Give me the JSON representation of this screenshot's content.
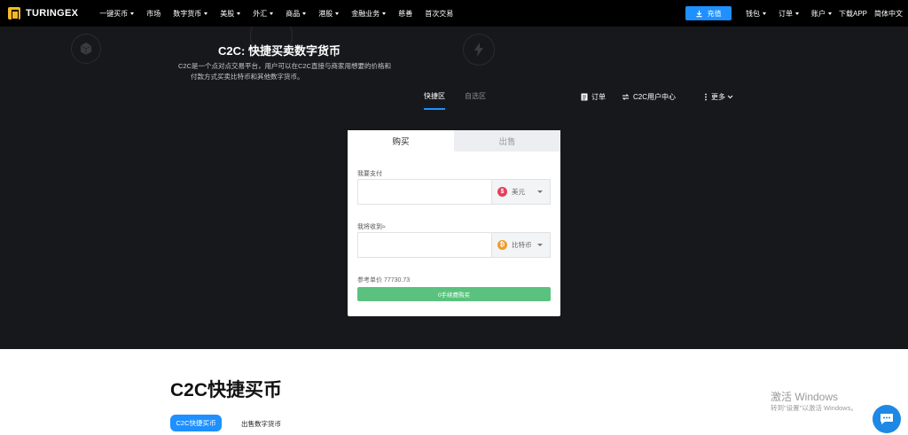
{
  "brand": {
    "name": "TURINGEX"
  },
  "nav": {
    "items": [
      {
        "label": "一键买币",
        "dropdown": true
      },
      {
        "label": "市场",
        "dropdown": false
      },
      {
        "label": "数字货币",
        "dropdown": true
      },
      {
        "label": "美股",
        "dropdown": true
      },
      {
        "label": "外汇",
        "dropdown": true
      },
      {
        "label": "商品",
        "dropdown": true
      },
      {
        "label": "港股",
        "dropdown": true
      },
      {
        "label": "金融业务",
        "dropdown": true
      },
      {
        "label": "慈善",
        "dropdown": false
      },
      {
        "label": "首次交易",
        "dropdown": false
      }
    ],
    "deposit_label": "充值",
    "wallet_label": "钱包",
    "orders_label": "订单",
    "account_label": "账户",
    "download_label": "下载APP",
    "language_label": "简体中文"
  },
  "hero": {
    "title": "C2C: 快捷买卖数字货币",
    "desc_line1": "C2C是一个点对点交易平台，用户可以在C2C直接与商家用想要的价格和",
    "desc_line2": "付款方式买卖比特币和其他数字货币。",
    "tabs": [
      "快捷区",
      "自选区"
    ],
    "active_tab": 0,
    "links": {
      "orders": "订单",
      "user_center": "C2C用户中心",
      "more": "更多"
    }
  },
  "trade": {
    "tab_buy": "购买",
    "tab_sell": "出售",
    "pay_label": "我要支付",
    "pay_currency": "美元",
    "receive_label": "我将收到≈",
    "receive_currency": "比特币",
    "ref_price_label": "参考单价",
    "ref_price_value": "77730.73",
    "buy_button": "0手续费购买"
  },
  "section": {
    "title": "C2C快捷买币",
    "tab_active": "C2C快捷买币",
    "tab_other": "出售数字货币"
  },
  "watermark": {
    "line1": "激活 Windows",
    "line2": "转到\"设置\"以激活 Windows。"
  },
  "colors": {
    "accent": "#1e90ff",
    "buy_green": "#5ac27e",
    "hero_bg": "#17181c",
    "nav_bg": "#000000"
  }
}
